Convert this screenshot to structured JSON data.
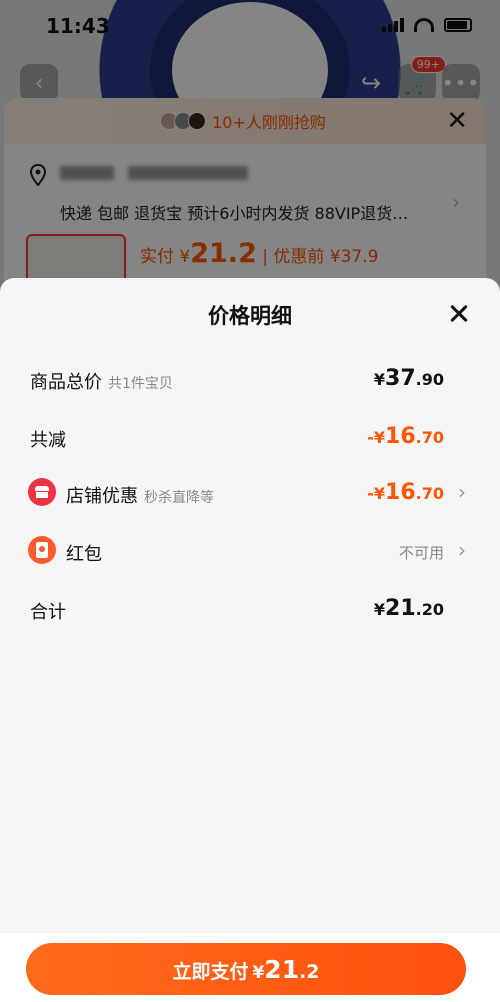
{
  "status_bar": {
    "time": "11:43"
  },
  "background": {
    "cart_badge": "99+",
    "banner_text": "10+人刚刚抢购",
    "delivery_tags": "快递 包邮 退货宝 预计6小时内发货 88VIP退货…",
    "actual_label": "实付 ¥",
    "actual_price": "21.2",
    "before_label": "| 优惠前 ¥37.9"
  },
  "modal": {
    "title": "价格明细",
    "rows": [
      {
        "label": "商品总价",
        "sub": "共1件宝贝",
        "currency": "¥",
        "int": "37",
        "dec": ".90"
      },
      {
        "label": "共减",
        "currency": "-¥",
        "int": "16",
        "dec": ".70"
      },
      {
        "label": "店铺优惠",
        "sub": "秒杀直降等",
        "currency": "-¥",
        "int": "16",
        "dec": ".70",
        "icon": "store-icon"
      },
      {
        "label": "红包",
        "status": "不可用",
        "icon": "red-packet-icon"
      },
      {
        "label": "合计",
        "currency": "¥",
        "int": "21",
        "dec": ".20"
      }
    ]
  },
  "footer": {
    "pay_label": "立即支付",
    "currency": "¥",
    "int": "21",
    "dec": ".2"
  },
  "colors": {
    "accent": "#ff5500",
    "button": "#ff5a14",
    "store_icon": "#ee3344"
  }
}
